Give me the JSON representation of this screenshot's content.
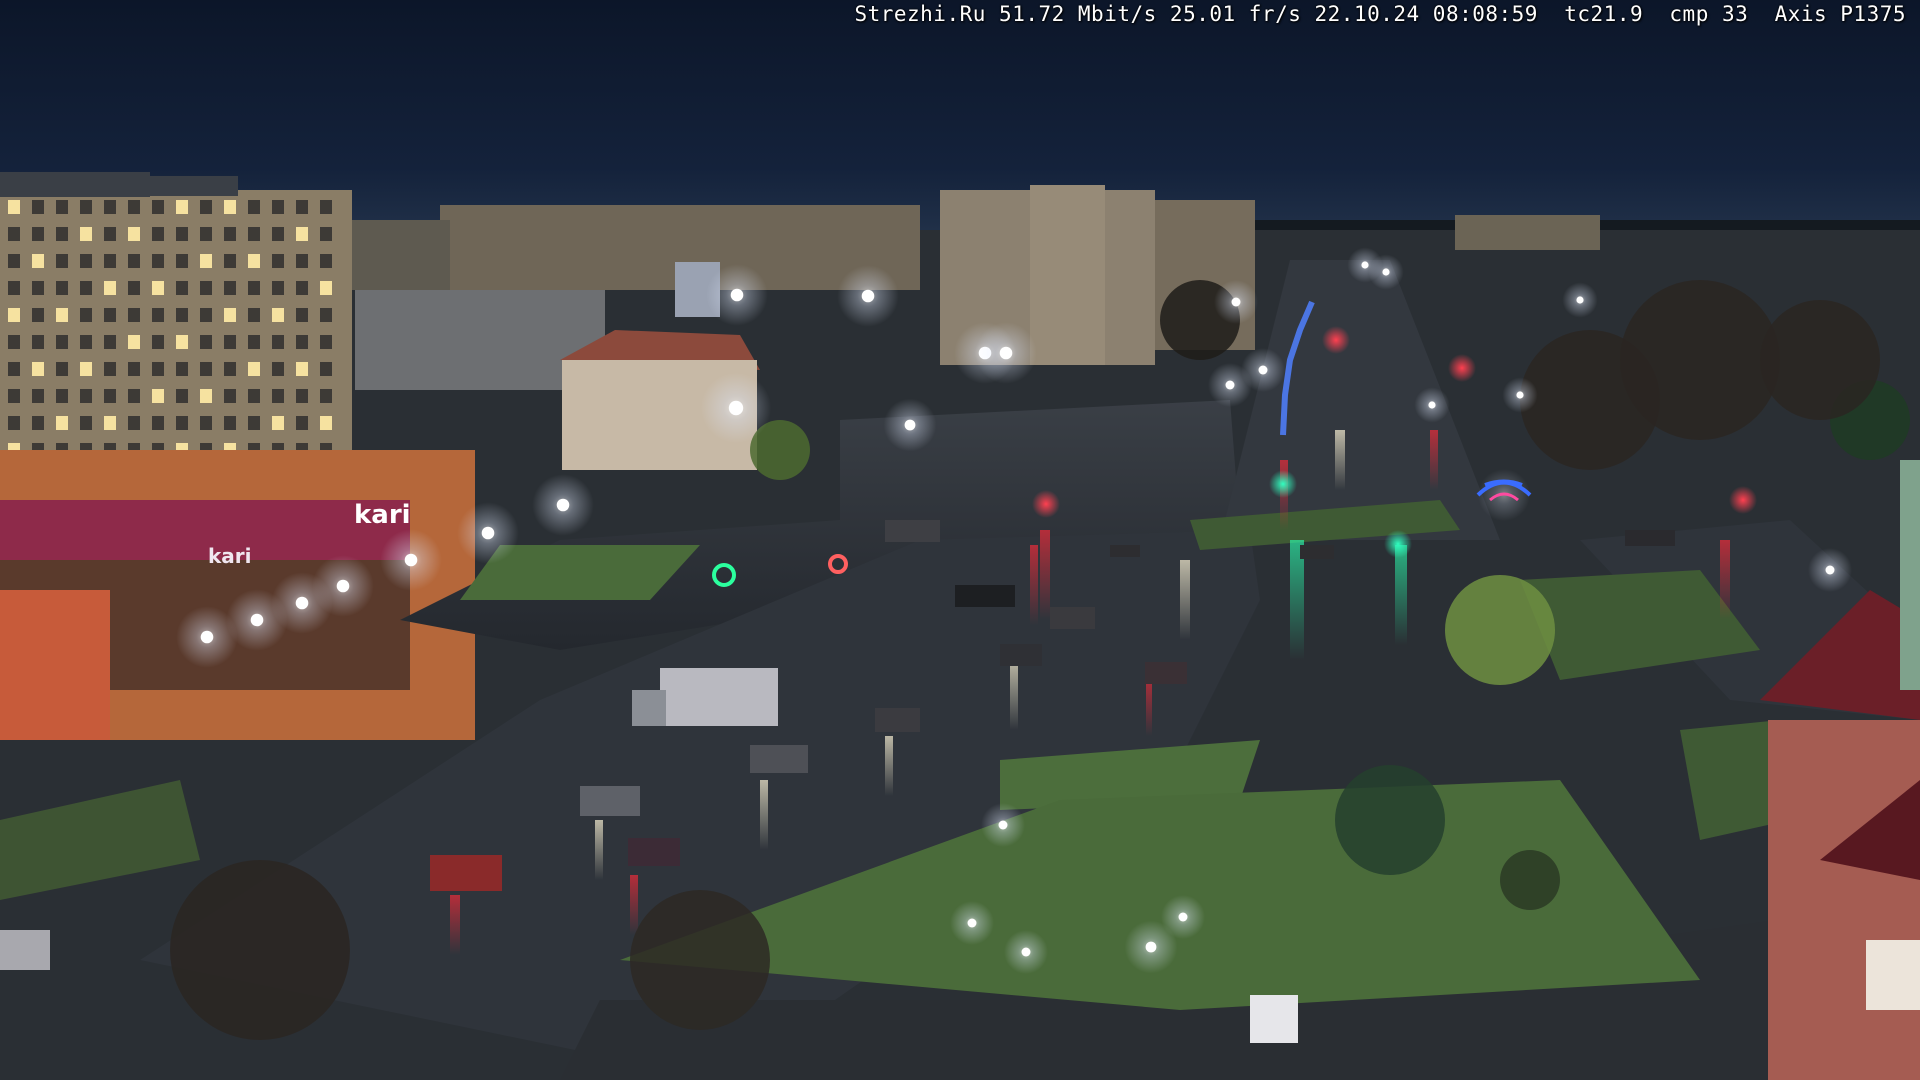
{
  "camera_overlay": {
    "site": "Strezhi.Ru",
    "bitrate": "51.72 Mbit/s",
    "framerate": "25.01 fr/s",
    "datetime": "22.10.24 08:08:59",
    "tc": "tc21.9",
    "cmp": "cmp 33",
    "camera_model": "Axis P1375"
  },
  "signage": {
    "store_sign": "kari"
  },
  "palette": {
    "sky": "#0f1c33",
    "sky_horizon": "#1f3350",
    "asphalt": "#2b3038",
    "grass": "#3f5a34",
    "building_panel": "#8a7d66",
    "store_facade": "#b5673a",
    "store_sign": "#8e2a4a",
    "street_light": "#f2f7ff",
    "traffic_red": "#ff2a3a",
    "traffic_green": "#2bffb0"
  }
}
